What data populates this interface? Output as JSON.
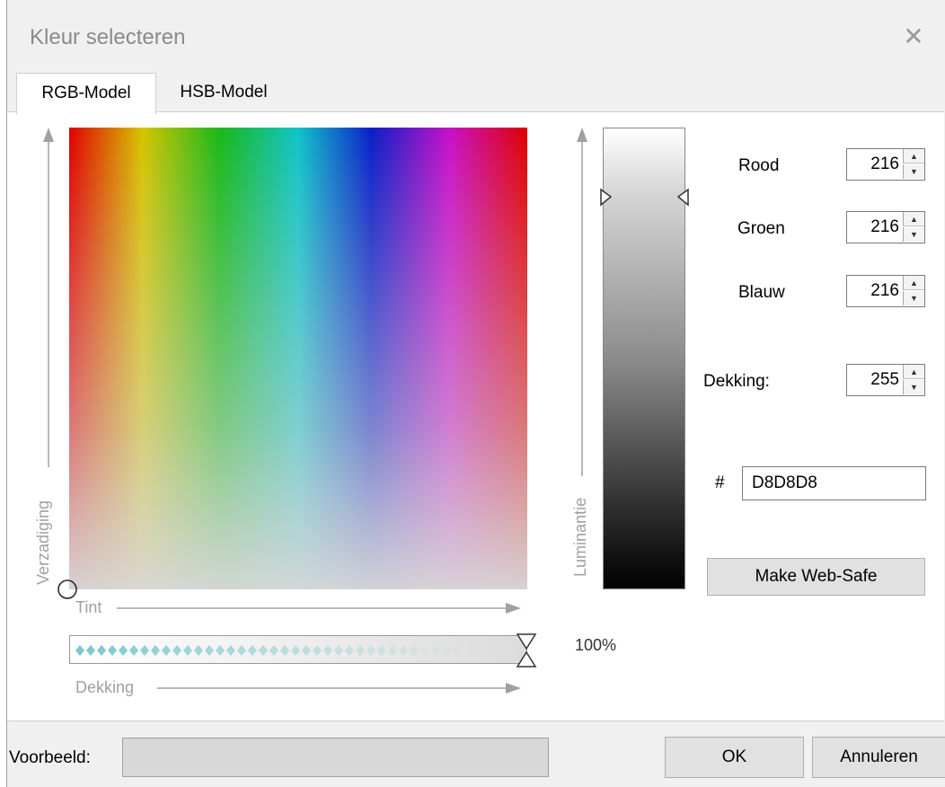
{
  "dialog": {
    "title": "Kleur selecteren",
    "close_symbol": "✕"
  },
  "tabs": [
    {
      "label": "RGB-Model",
      "active": true
    },
    {
      "label": "HSB-Model",
      "active": false
    }
  ],
  "spectrum": {
    "x_axis_label": "Tint",
    "y_axis_label": "Verzadiging"
  },
  "luminance": {
    "axis_label": "Luminantie"
  },
  "opacity": {
    "axis_label": "Dekking",
    "percent": "100%"
  },
  "fields": {
    "red": {
      "label": "Rood",
      "value": "216"
    },
    "green": {
      "label": "Groen",
      "value": "216"
    },
    "blue": {
      "label": "Blauw",
      "value": "216"
    },
    "alpha": {
      "label": "Dekking:",
      "value": "255"
    }
  },
  "hex": {
    "symbol": "#",
    "value": "D8D8D8"
  },
  "buttons": {
    "web_safe": "Make  Web-Safe",
    "ok": "OK",
    "cancel": "Annuleren"
  },
  "preview": {
    "label": "Voorbeeld:",
    "color": "#d8d8d8"
  },
  "icons": {
    "spin_up": "spin-up-arrow",
    "spin_down": "spin-down-arrow",
    "close": "close-icon"
  }
}
